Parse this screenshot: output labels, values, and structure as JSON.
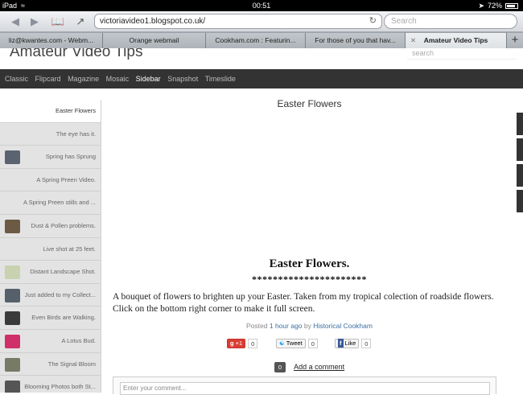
{
  "status": {
    "carrier": "iPad",
    "time": "00:51",
    "battery": "72%"
  },
  "browser": {
    "url": "victoriavideo1.blogspot.co.uk/",
    "search_placeholder": "Search",
    "tabs": [
      {
        "label": "liz@kwantes.com - Webm..."
      },
      {
        "label": "Orange webmail"
      },
      {
        "label": "Cookham.com : Featurin..."
      },
      {
        "label": "For those of you that hav..."
      },
      {
        "label": "Amateur Video Tips",
        "active": true
      }
    ]
  },
  "blog": {
    "title": "Amateur Video Tips",
    "search_placeholder": "search",
    "views": [
      "Classic",
      "Flipcard",
      "Magazine",
      "Mosaic",
      "Sidebar",
      "Snapshot",
      "Timeslide"
    ],
    "active_view": "Sidebar"
  },
  "sidebar": {
    "items": [
      {
        "label": "Easter Flowers",
        "active": true
      },
      {
        "label": "The eye has it."
      },
      {
        "label": "Spring has Sprung",
        "thumb": "#5a6470"
      },
      {
        "label": "A Spring Preen Video."
      },
      {
        "label": "A Spring Preen stills and ..."
      },
      {
        "label": "Dust & Pollen problems.",
        "thumb": "#6d5a44"
      },
      {
        "label": "Live shot at 25 feet."
      },
      {
        "label": "Distant Landscape Shot.",
        "thumb": "#c9d2b0"
      },
      {
        "label": "Just added to my Collect...",
        "thumb": "#55606a"
      },
      {
        "label": "Even Birds are Walking.",
        "thumb": "#3a3a3a"
      },
      {
        "label": "A Lotus Bud.",
        "thumb": "#d0306a"
      },
      {
        "label": "The Signal Bloom",
        "thumb": "#777b66"
      },
      {
        "label": "Blooming Photos both St...",
        "thumb": "#555"
      }
    ]
  },
  "post": {
    "header": "Easter Flowers",
    "title": "Easter Flowers.",
    "stars": "**********************",
    "body": "A bouquet of flowers to brighten up your Easter. Taken from my tropical colection of roadside flowers. Click on the bottom right corner to make it full screen.",
    "posted_prefix": "Posted",
    "posted_time": "1 hour ago",
    "by": "by",
    "author": "Historical Cookham",
    "gplus_label": "+1",
    "gplus_count": "0",
    "tweet_label": "Tweet",
    "tweet_count": "0",
    "like_label": "Like",
    "like_count": "0",
    "comment_count": "0",
    "add_comment": "Add a comment",
    "comment_placeholder": "Enter your comment..."
  }
}
